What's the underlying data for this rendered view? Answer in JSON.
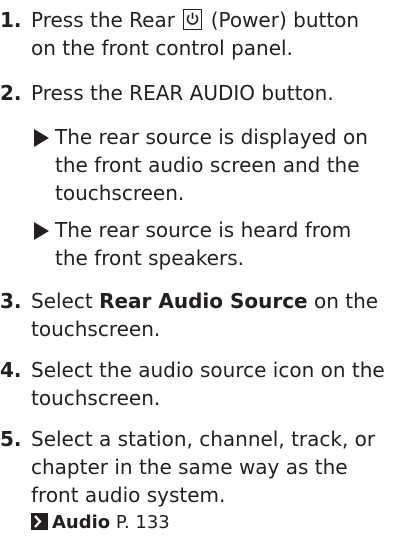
{
  "steps": [
    {
      "num": "1.",
      "line1a": "Press the Rear",
      "line1b": "(Power) button",
      "line2": "on the front control panel."
    },
    {
      "num": "2.",
      "line1": "Press the REAR AUDIO button."
    },
    {
      "num": "3.",
      "bold": "Rear Audio Source",
      "line1rest": "on the",
      "line2": "touchscreen."
    },
    {
      "num": "4.",
      "line1": "Select the audio source icon on the",
      "line2": "touchscreen."
    },
    {
      "num": "5.",
      "line1": "Select a station, channel, track, or",
      "line2": "chapter in the same way as the",
      "line3": "front audio system.",
      "ref_label": "Audio",
      "ref_page": "P. 133"
    }
  ],
  "step3_prefix": "Select",
  "notes": [
    {
      "line1": "The rear source is displayed on",
      "line2": "the front audio screen and the",
      "line3": "touchscreen."
    },
    {
      "line1": "The rear source is heard from",
      "line2": "the front speakers."
    }
  ],
  "icons": [
    "power-icon",
    "triangle-bullet-icon",
    "reference-arrow-icon"
  ]
}
